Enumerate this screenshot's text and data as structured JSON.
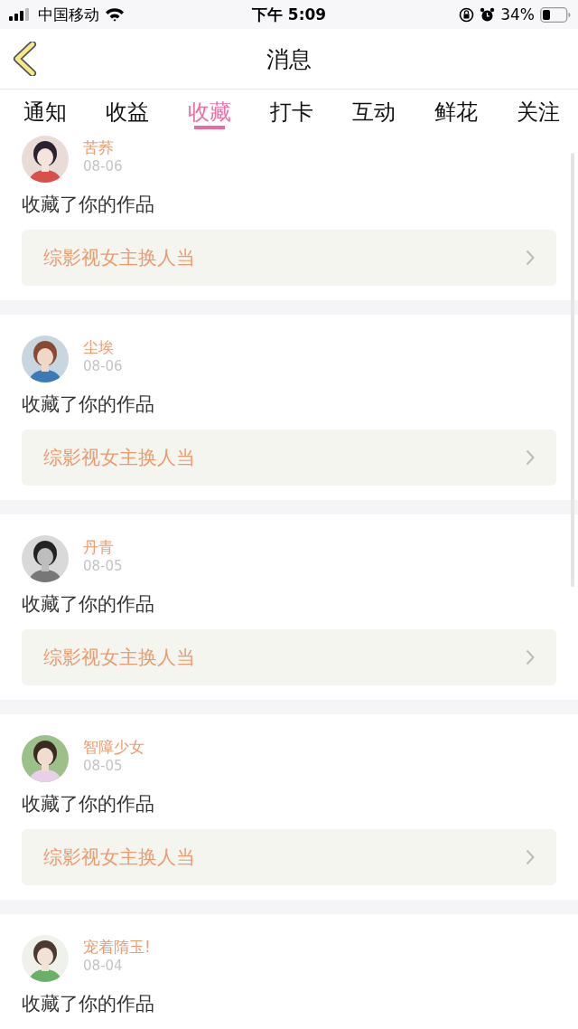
{
  "status_bar": {
    "carrier": "中国移动",
    "time": "下午 5:09",
    "battery": "34%"
  },
  "nav": {
    "title": "消息"
  },
  "tabs": [
    {
      "label": "通知",
      "selected": false
    },
    {
      "label": "收益",
      "selected": false
    },
    {
      "label": "收藏",
      "selected": true
    },
    {
      "label": "打卡",
      "selected": false
    },
    {
      "label": "互动",
      "selected": false
    },
    {
      "label": "鲜花",
      "selected": false
    },
    {
      "label": "关注",
      "selected": false
    }
  ],
  "messages": [
    {
      "name": "苦荞",
      "date": "08-06",
      "text": "收藏了你的作品",
      "work": "综影视女主换人当"
    },
    {
      "name": "尘埃",
      "date": "08-06",
      "text": "收藏了你的作品",
      "work": "综影视女主换人当"
    },
    {
      "name": "丹青",
      "date": "08-05",
      "text": "收藏了你的作品",
      "work": "综影视女主换人当"
    },
    {
      "name": "智障少女",
      "date": "08-05",
      "text": "收藏了你的作品",
      "work": "综影视女主换人当"
    },
    {
      "name": "宠着隋玉!",
      "date": "08-04",
      "text": "收藏了你的作品"
    }
  ]
}
